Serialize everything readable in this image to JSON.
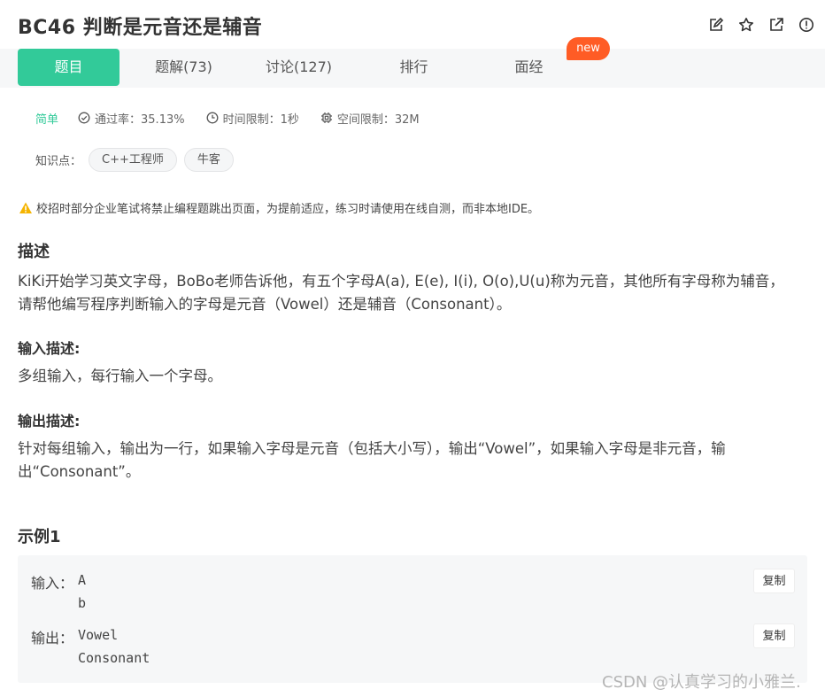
{
  "header": {
    "title": "BC46  判断是元音还是辅音",
    "icons": [
      "edit-icon",
      "star-icon",
      "share-icon",
      "report-icon"
    ]
  },
  "tabs": [
    {
      "label": "题目",
      "active": true
    },
    {
      "label": "题解(73)",
      "active": false
    },
    {
      "label": "讨论(127)",
      "active": false
    },
    {
      "label": "排行",
      "active": false
    },
    {
      "label": "面经",
      "active": false
    }
  ],
  "new_badge": "new",
  "meta": {
    "difficulty": "简单",
    "pass_rate": "通过率：35.13%",
    "time_limit": "时间限制：1秒",
    "space_limit": "空间限制：32M"
  },
  "knowledge": {
    "label": "知识点：",
    "tags": [
      "C++工程师",
      "牛客"
    ]
  },
  "warning": "校招时部分企业笔试将禁止编程题跳出页面，为提前适应，练习时请使用在线自测，而非本地IDE。",
  "description": {
    "heading": "描述",
    "text": "KiKi开始学习英文字母，BoBo老师告诉他，有五个字母A(a), E(e), I(i), O(o),U(u)称为元音，其他所有字母称为辅音，请帮他编写程序判断输入的字母是元音（Vowel）还是辅音（Consonant）。"
  },
  "input_desc": {
    "heading": "输入描述:",
    "text": "多组输入，每行输入一个字母。"
  },
  "output_desc": {
    "heading": "输出描述:",
    "text": "针对每组输入，输出为一行，如果输入字母是元音（包括大小写），输出“Vowel”，如果输入字母是非元音，输出“Consonant”。"
  },
  "example": {
    "heading": "示例1",
    "input_label": "输入：",
    "input_value": "A\nb",
    "output_label": "输出：",
    "output_value": "Vowel\nConsonant",
    "copy_label": "复制"
  },
  "watermark": "CSDN @认真学习的小雅兰.",
  "colors": {
    "accent": "#32ca99",
    "badge": "#ff5c25",
    "warning": "#f5b400"
  }
}
